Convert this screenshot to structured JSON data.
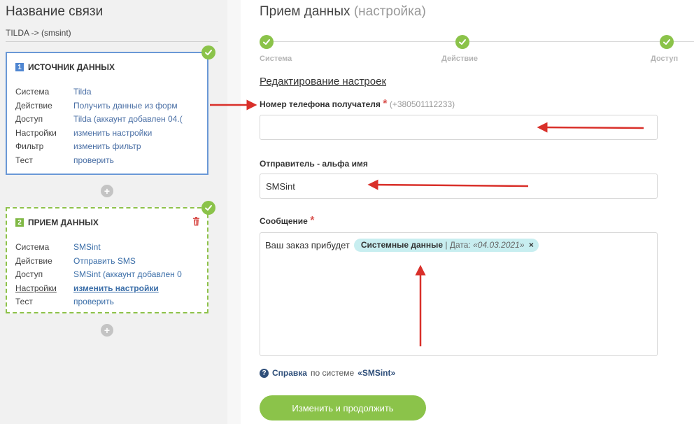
{
  "left": {
    "title": "Название связи",
    "connection_name": "TILDA -> (smsint)",
    "source_card": {
      "number": "1",
      "title": "ИСТОЧНИК ДАННЫХ",
      "rows": [
        {
          "key": "Система",
          "value": "Tilda"
        },
        {
          "key": "Действие",
          "value": "Получить данные из форм"
        },
        {
          "key": "Доступ",
          "value": "Tilda (аккаунт добавлен 04.("
        },
        {
          "key": "Настройки",
          "value": "изменить настройки"
        },
        {
          "key": "Фильтр",
          "value": "изменить фильтр"
        },
        {
          "key": "Тест",
          "value": "проверить"
        }
      ]
    },
    "receive_card": {
      "number": "2",
      "title": "ПРИЕМ ДАННЫХ",
      "rows": [
        {
          "key": "Система",
          "value": "SMSint"
        },
        {
          "key": "Действие",
          "value": "Отправить SMS"
        },
        {
          "key": "Доступ",
          "value": "SMSint (аккаунт добавлен 0"
        },
        {
          "key": "Настройки",
          "value": "изменить настройки"
        },
        {
          "key": "Тест",
          "value": "проверить"
        }
      ]
    },
    "plus_label": "+"
  },
  "main": {
    "title": "Прием данных",
    "title_suffix": "(настройка)",
    "steps": [
      {
        "label": "Система"
      },
      {
        "label": "Действие"
      },
      {
        "label": "Доступ"
      }
    ],
    "edit_title": "Редактирование настроек",
    "phone": {
      "label": "Номер телефона получателя",
      "required": "*",
      "hint": "(+380501112233)",
      "value": ""
    },
    "sender": {
      "label": "Отправитель - альфа имя",
      "value": "SMSint"
    },
    "message": {
      "label": "Сообщение",
      "required": "*",
      "text": "Ваш заказ прибудет",
      "tag_source": "Системные данные",
      "tag_sep": "|",
      "tag_field": "Дата:",
      "tag_value": "«04.03.2021»",
      "tag_remove": "×"
    },
    "help": {
      "icon": "?",
      "link": "Справка",
      "text": "по системе",
      "system": "«SMSint»"
    },
    "submit_label": "Изменить и продолжить"
  },
  "colors": {
    "accent_green": "#8bc34a",
    "accent_blue": "#4f86d1",
    "arrow_red": "#d9302a",
    "tag_bg": "#c8eef0"
  }
}
